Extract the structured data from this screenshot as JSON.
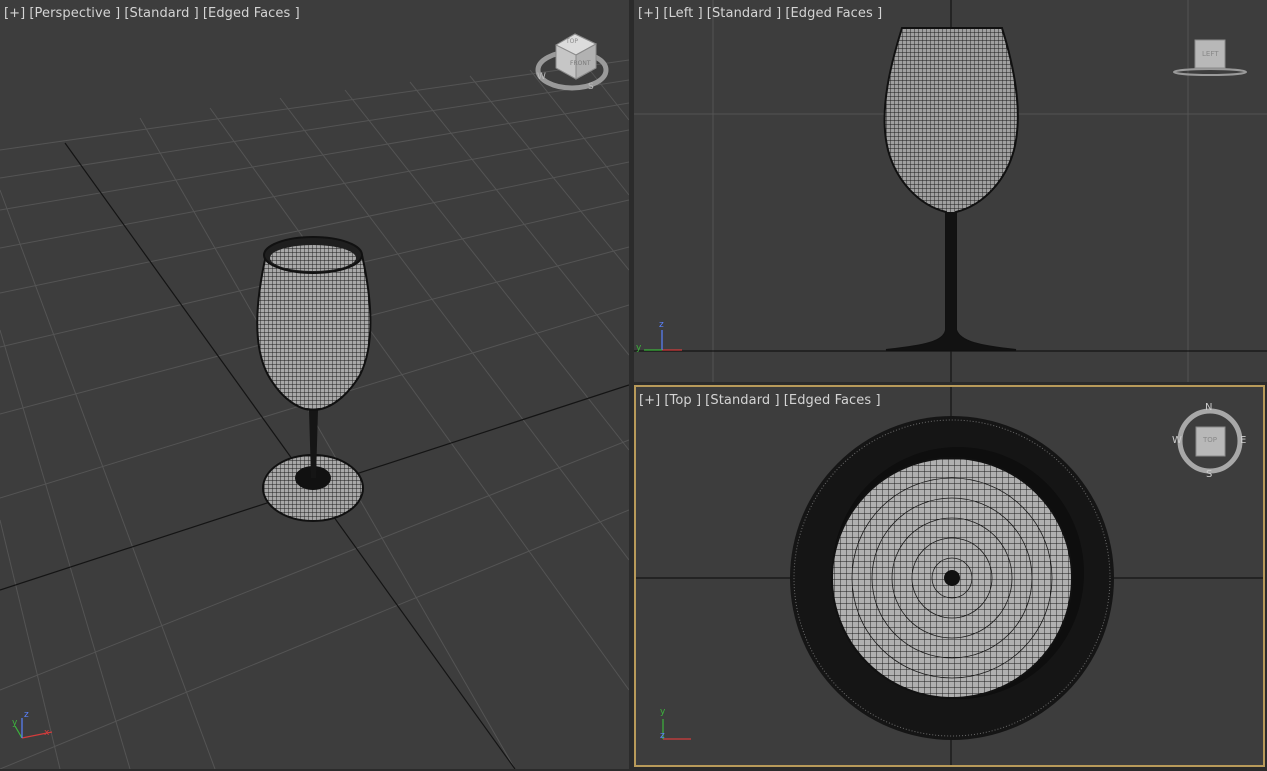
{
  "viewports": {
    "perspective": {
      "plus": "[+]",
      "view": "[Perspective ]",
      "shading": "[Standard ]",
      "edges": "[Edged Faces ]",
      "viewcube": {
        "top": "TOP",
        "front": "FRONT",
        "compass": {
          "w": "W",
          "s": "S"
        }
      }
    },
    "left": {
      "plus": "[+]",
      "view": "[Left ]",
      "shading": "[Standard ]",
      "edges": "[Edged Faces ]",
      "viewcube": {
        "face": "LEFT"
      }
    },
    "top": {
      "plus": "[+]",
      "view": "[Top ]",
      "shading": "[Standard ]",
      "edges": "[Edged Faces ]",
      "viewcube": {
        "face": "TOP",
        "n": "N",
        "s": "S",
        "e": "E",
        "w": "W"
      }
    }
  },
  "axis": {
    "x": "x",
    "y": "y",
    "z": "z"
  },
  "colors": {
    "viewport_bg": "#3d3d3d",
    "active_border": "#b89a5a",
    "grid": "#545454",
    "grid_major": "#1a1a1a",
    "label": "#d4d4d4",
    "axis_x": "#d23c3c",
    "axis_y": "#3cb43c",
    "axis_z": "#5a82ff"
  }
}
